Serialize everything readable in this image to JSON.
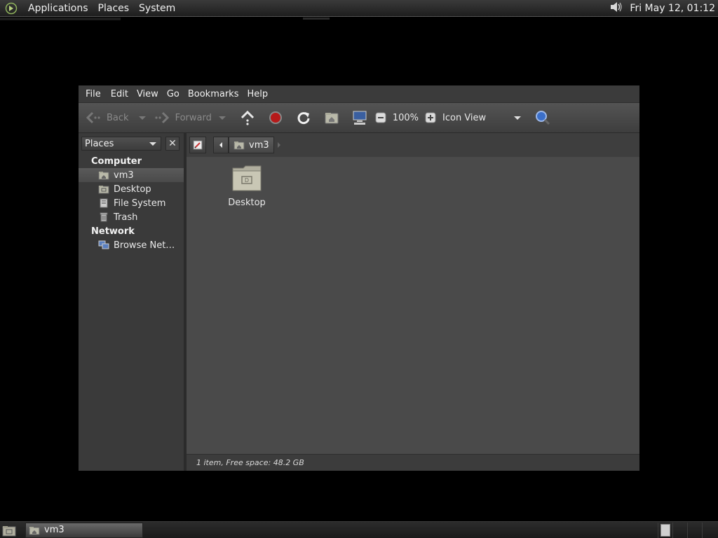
{
  "top_panel": {
    "menus": [
      "Applications",
      "Places",
      "System"
    ],
    "clock": "Fri May 12, 01:12"
  },
  "window": {
    "menubar": [
      "File",
      "Edit",
      "View",
      "Go",
      "Bookmarks",
      "Help"
    ],
    "toolbar": {
      "back": "Back",
      "forward": "Forward",
      "zoom": "100%",
      "view_mode": "Icon View"
    },
    "sidebar": {
      "selector": "Places",
      "groups": [
        {
          "title": "Computer",
          "items": [
            {
              "label": "vm3",
              "icon": "home-folder-icon",
              "selected": true
            },
            {
              "label": "Desktop",
              "icon": "desktop-folder-icon"
            },
            {
              "label": "File System",
              "icon": "drive-icon"
            },
            {
              "label": "Trash",
              "icon": "trash-icon"
            }
          ]
        },
        {
          "title": "Network",
          "items": [
            {
              "label": "Browse Net…",
              "icon": "network-icon"
            }
          ]
        }
      ]
    },
    "pathbar": {
      "current": "vm3"
    },
    "files": [
      {
        "label": "Desktop",
        "icon": "desktop-folder-icon"
      }
    ],
    "status": "1 item, Free space: 48.2 GB"
  },
  "bottom_panel": {
    "task": "vm3"
  }
}
